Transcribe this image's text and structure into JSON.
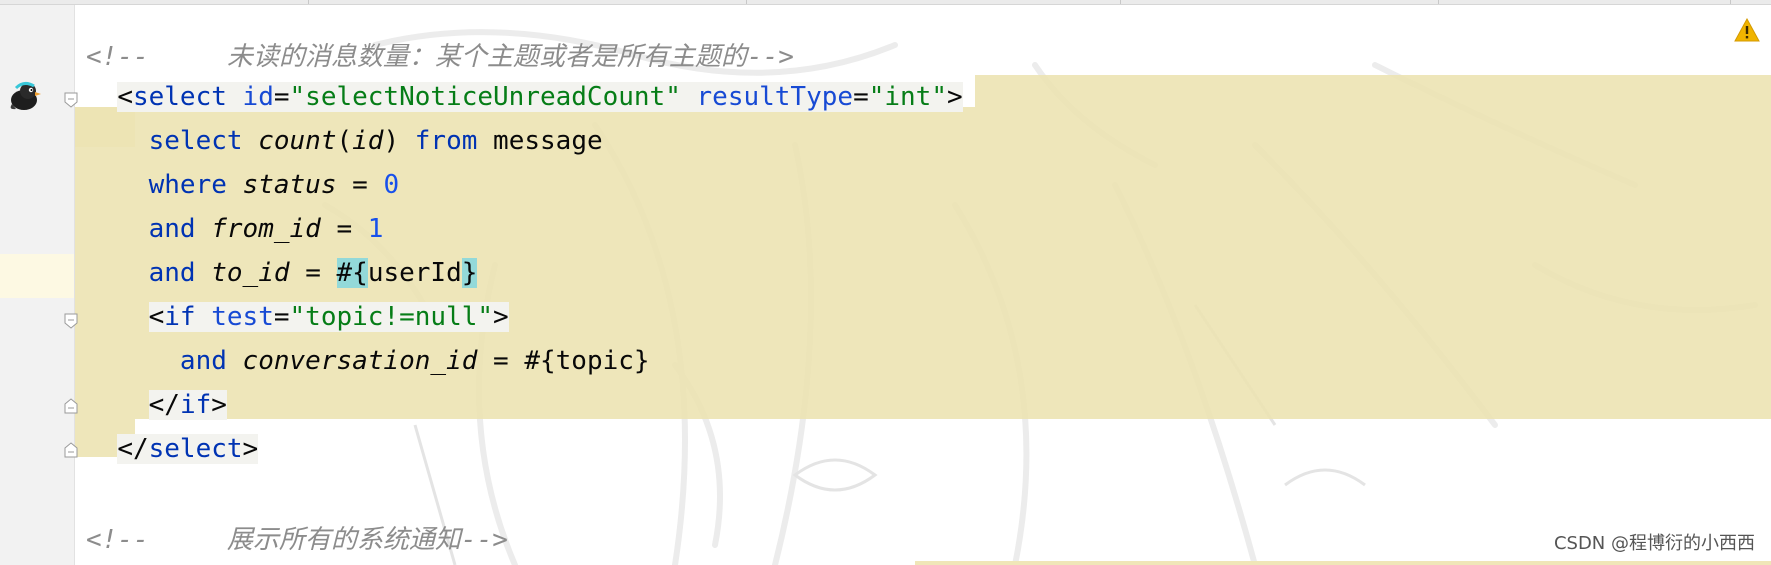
{
  "editor": {
    "lines": {
      "comment1": {
        "open": "<!--",
        "text": "未读的消息数量：某个主题或者是所有主题的",
        "close": "-->"
      },
      "select_open": {
        "lt": "<",
        "tag": "select",
        "attr1": "id",
        "eq1": "=",
        "val1": "\"selectNoticeUnreadCount\"",
        "attr2": "resultType",
        "eq2": "=",
        "val2": "\"int\"",
        "gt": ">"
      },
      "line3": {
        "kw1": "select",
        "fn": "count",
        "paren_open": "(",
        "arg": "id",
        "paren_close": ")",
        "kw2": "from",
        "table": "message"
      },
      "line4": {
        "kw": "where",
        "field": "status",
        "op": "=",
        "num": "0"
      },
      "line5": {
        "kw": "and",
        "field": "from_id",
        "op": "=",
        "num": "1"
      },
      "line6": {
        "kw": "and",
        "field": "to_id",
        "op": "=",
        "hash": "#",
        "brace_open": "{",
        "param": "userId",
        "brace_close": "}"
      },
      "if_open": {
        "lt": "<",
        "tag": "if",
        "attr": "test",
        "eq": "=",
        "val": "\"topic!=null\"",
        "gt": ">"
      },
      "line8": {
        "kw": "and",
        "field": "conversation_id",
        "op": "=",
        "expr": "#{topic}"
      },
      "if_close": {
        "lt": "</",
        "tag": "if",
        "gt": ">"
      },
      "select_close": {
        "lt": "</",
        "tag": "select",
        "gt": ">"
      },
      "comment2": {
        "open": "<!--",
        "text": "展示所有的系统通知",
        "close": "-->"
      }
    }
  },
  "icons": {
    "avatar": "bird-avatar-icon",
    "warning": "warning-triangle-icon",
    "fold_open": "fold-open-icon",
    "fold_close": "fold-close-icon"
  },
  "colors": {
    "tag": "#0033b3",
    "attribute": "#174ad4",
    "string": "#067d17",
    "comment": "#8c8c8c",
    "number": "#1750eb",
    "highlight": "#ece2b0",
    "brace_match": "#93d9d9",
    "warning": "#f0b400"
  },
  "watermark": "CSDN @程博衍的小西西"
}
